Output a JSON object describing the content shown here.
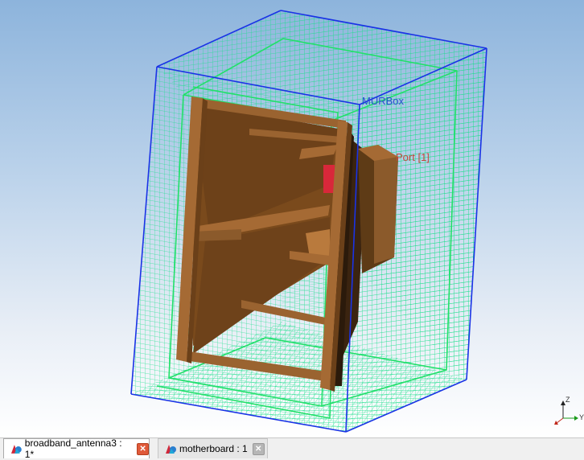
{
  "viewport": {
    "labels": {
      "mur_box": "MURBox",
      "port": "Port [1]"
    },
    "colors": {
      "background_top": "#8db4dc",
      "background_bottom": "#ffffff",
      "mesh_green": "#19e08a",
      "box_edge_blue": "#1a33e6",
      "horn_brown": "#8b5a2b",
      "horn_dark": "#5e3b16",
      "port_red": "#d8283a",
      "mur_label_color": "#2a4fd0",
      "port_label_color": "#c04a3a"
    }
  },
  "axis_triad": {
    "z_label": "Z",
    "y_label": "Y"
  },
  "tabs": [
    {
      "label": "broadband_antenna3 : 1*",
      "icon": "model-icon",
      "close_icon": "close-icon",
      "active": true
    },
    {
      "label": "motherboard : 1",
      "icon": "model-icon",
      "close_icon": "close-icon",
      "active": false
    }
  ]
}
